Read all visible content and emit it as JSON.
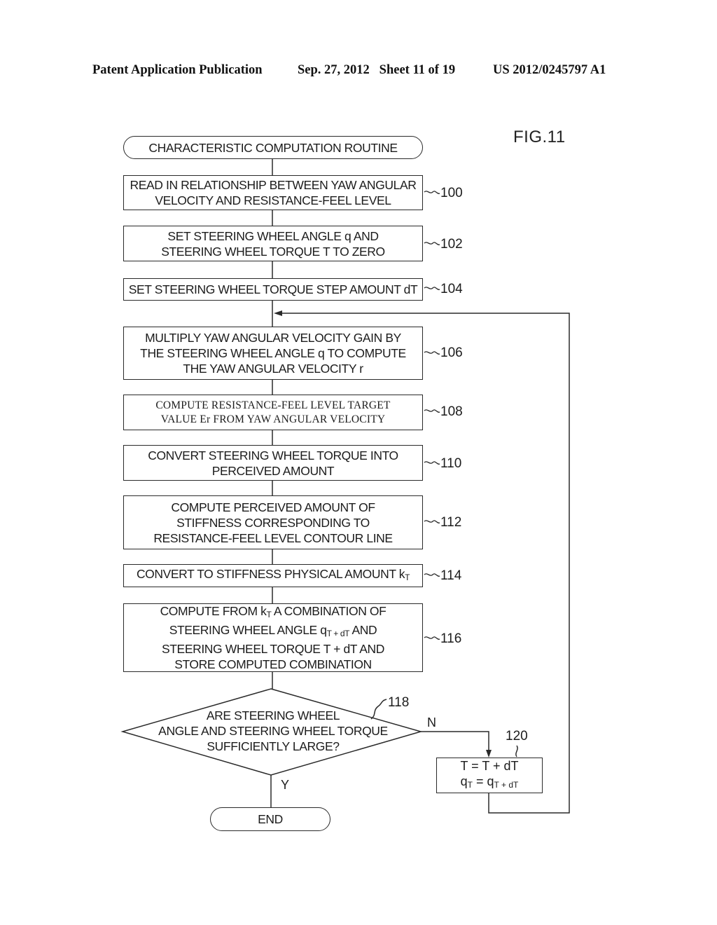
{
  "header": {
    "publication_type": "Patent Application Publication",
    "date_sheet": "Sep. 27, 2012   Sheet 11 of 19",
    "patent_number": "US 2012/0245797 A1"
  },
  "figure_label": "FIG.11",
  "flowchart": {
    "start": "CHARACTERISTIC COMPUTATION ROUTINE",
    "steps": [
      {
        "ref": "100",
        "text": "READ IN RELATIONSHIP BETWEEN YAW ANGULAR\nVELOCITY AND RESISTANCE-FEEL LEVEL"
      },
      {
        "ref": "102",
        "text": "SET STEERING WHEEL ANGLE q AND\nSTEERING WHEEL TORQUE T TO ZERO"
      },
      {
        "ref": "104",
        "text": "SET STEERING WHEEL TORQUE STEP AMOUNT dT"
      },
      {
        "ref": "106",
        "text": "MULTIPLY YAW ANGULAR VELOCITY GAIN BY\nTHE STEERING WHEEL ANGLE q TO COMPUTE\nTHE YAW ANGULAR VELOCITY r"
      },
      {
        "ref": "108",
        "text": "COMPUTE RESISTANCE-FEEL LEVEL TARGET\nVALUE Er FROM YAW ANGULAR VELOCITY"
      },
      {
        "ref": "110",
        "text": "CONVERT STEERING WHEEL TORQUE INTO\nPERCEIVED AMOUNT"
      },
      {
        "ref": "112",
        "text": "COMPUTE PERCEIVED AMOUNT OF\nSTIFFNESS CORRESPONDING TO\nRESISTANCE-FEEL LEVEL CONTOUR LINE"
      },
      {
        "ref": "114",
        "text_main": "CONVERT TO STIFFNESS PHYSICAL AMOUNT k",
        "text_sub": "T"
      },
      {
        "ref": "116",
        "line1_main": "COMPUTE FROM k",
        "line1_sub": "T",
        "line1_rest": " A COMBINATION OF",
        "line2_main": "STEERING WHEEL ANGLE q",
        "line2_sub": "T + dT",
        "line2_rest": " AND",
        "line3": "STEERING WHEEL TORQUE T + dT AND",
        "line4": "STORE COMPUTED COMBINATION"
      }
    ],
    "decision": {
      "ref": "118",
      "text": "ARE STEERING WHEEL\nANGLE AND STEERING WHEEL TORQUE\nSUFFICIENTLY LARGE?",
      "yes_label": "Y",
      "no_label": "N"
    },
    "update_step": {
      "ref": "120",
      "line1": "T = T + dT",
      "line2_main": "q",
      "line2_sub": "T",
      "line2_eq": " = q",
      "line2_sub2": "T + dT"
    },
    "end": "END"
  }
}
